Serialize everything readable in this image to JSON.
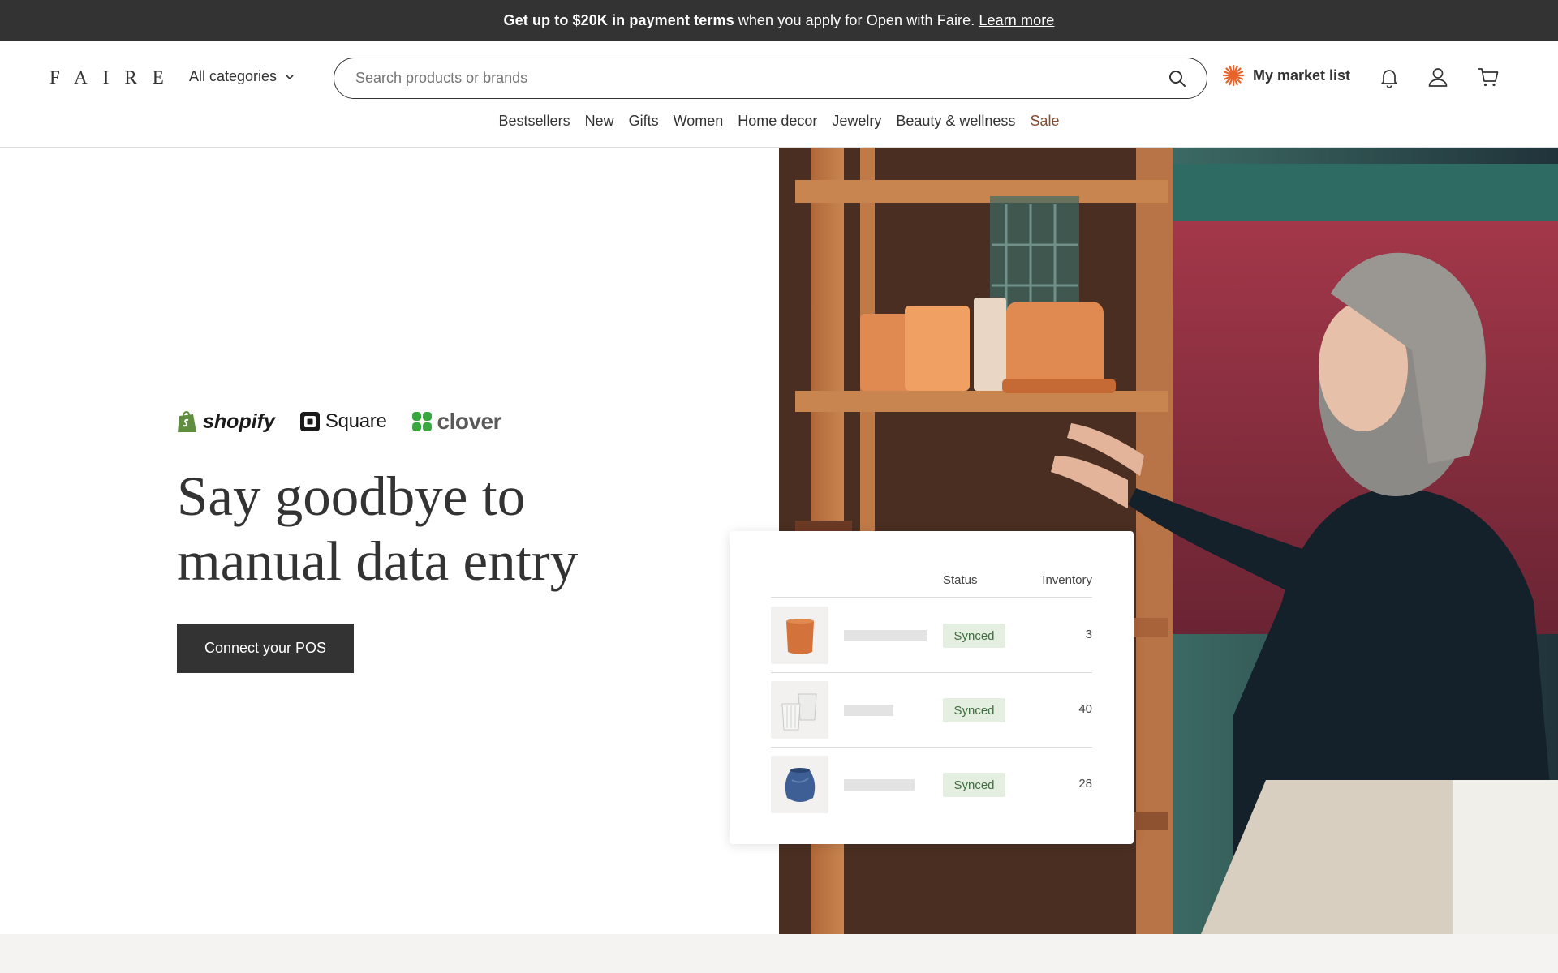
{
  "promo": {
    "bold_text": "Get up to $20K in payment terms",
    "text": "when you apply for Open with Faire.",
    "link": "Learn more"
  },
  "header": {
    "logo": "FAIRE",
    "categories_label": "All categories",
    "search_placeholder": "Search products or brands",
    "market_list_label": "My market list",
    "icons": [
      "search-icon",
      "sunburst-icon",
      "bell-icon",
      "user-icon",
      "cart-icon",
      "chevron-down-icon"
    ],
    "nav": [
      "Bestsellers",
      "New",
      "Gifts",
      "Women",
      "Home decor",
      "Jewelry",
      "Beauty & wellness",
      "Sale"
    ]
  },
  "hero": {
    "pos_logos": [
      "shopify",
      "Square",
      "clover"
    ],
    "headline_line1": "Say goodbye to",
    "headline_line2": "manual data entry",
    "cta_label": "Connect your POS"
  },
  "inventory_card": {
    "columns": {
      "status": "Status",
      "inventory": "Inventory"
    },
    "rows": [
      {
        "status": "Synced",
        "inventory": "3",
        "product": "terracotta-planter"
      },
      {
        "status": "Synced",
        "inventory": "40",
        "product": "white-ribbed-cups"
      },
      {
        "status": "Synced",
        "inventory": "28",
        "product": "blue-ceramic-vase"
      }
    ]
  },
  "colors": {
    "banner_bg": "#333333",
    "cta_bg": "#333333",
    "sale_text": "#8a4a2a",
    "synced_bg": "#e4efe2",
    "synced_text": "#3f6f3e",
    "market_icon": "#e8622c"
  }
}
